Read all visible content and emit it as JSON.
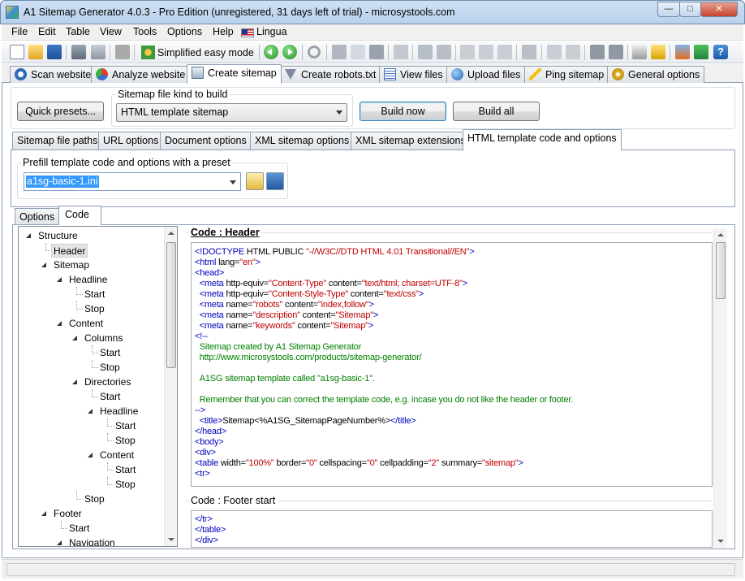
{
  "window": {
    "title": "A1 Sitemap Generator 4.0.3 - Pro Edition (unregistered, 31 days left of trial) - microsystools.com"
  },
  "menu": [
    "File",
    "Edit",
    "Table",
    "View",
    "Tools",
    "Options",
    "Help",
    "Lingua"
  ],
  "toolbar": {
    "simplified_label": "Simplified easy mode"
  },
  "main_tabs": [
    "Scan website",
    "Analyze website",
    "Create sitemap",
    "Create robots.txt",
    "View files",
    "Upload files",
    "Ping sitemap",
    "General options"
  ],
  "build": {
    "quick_presets": "Quick presets...",
    "kind_label": "Sitemap file kind to build",
    "kind_value": "HTML template sitemap",
    "build_now": "Build now",
    "build_all": "Build all"
  },
  "sub_tabs": [
    "Sitemap file paths",
    "URL options",
    "Document options",
    "XML sitemap options",
    "XML sitemap extensions",
    "HTML template code and options"
  ],
  "prefill": {
    "label": "Prefill template code and options with a preset",
    "value": "a1sg-basic-1.ini"
  },
  "inner_tabs": [
    "Options",
    "Code"
  ],
  "tree": [
    "Structure",
    "Header",
    "Sitemap",
    "Headline",
    "Start",
    "Stop",
    "Content",
    "Columns",
    "Start",
    "Stop",
    "Directories",
    "Start",
    "Headline",
    "Start",
    "Stop",
    "Content",
    "Start",
    "Stop",
    "Stop",
    "Footer",
    "Start",
    "Navigation"
  ],
  "code_header": {
    "label": "Code : Header"
  },
  "code_footer": {
    "label": "Code : Footer start"
  },
  "colors": {
    "tag": "#0000c0",
    "attr": "#c00000",
    "comment": "#008000",
    "accent": "#3c7fb1"
  }
}
